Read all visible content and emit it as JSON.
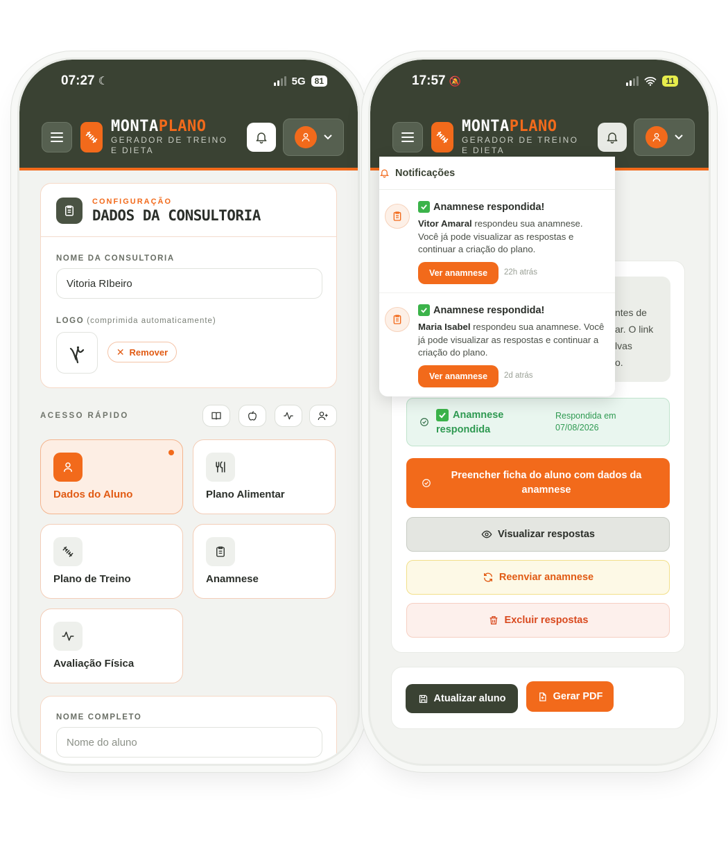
{
  "left": {
    "status": {
      "time": "07:27",
      "network": "5G",
      "battery": "81"
    },
    "brand": {
      "title_a": "MONTA",
      "title_b": "PLANO",
      "subtitle": "GERADOR DE TREINO E DIETA"
    },
    "config_card": {
      "eyebrow": "CONFIGURAÇÃO",
      "title": "DADOS DA CONSULTORIA",
      "name_label": "NOME DA CONSULTORIA",
      "name_value": "Vitoria RIbeiro",
      "logo_label": "LOGO",
      "logo_hint": "(comprimida automaticamente)",
      "remove_label": "Remover"
    },
    "quick_access": {
      "label": "ACESSO RÁPIDO",
      "tiles": [
        {
          "label": "Dados do Aluno",
          "icon": "user-icon",
          "active": true
        },
        {
          "label": "Plano Alimentar",
          "icon": "fork-knife-icon",
          "active": false
        },
        {
          "label": "Plano de Treino",
          "icon": "dumbbell-icon",
          "active": false
        },
        {
          "label": "Anamnese",
          "icon": "clipboard-icon",
          "active": false
        },
        {
          "label": "Avaliação Física",
          "icon": "pulse-icon",
          "active": false
        }
      ]
    },
    "student_card": {
      "label": "NOME COMPLETO",
      "placeholder": "Nome do aluno"
    }
  },
  "right": {
    "status": {
      "time": "17:57",
      "battery": "11"
    },
    "brand": {
      "title_a": "MONTA",
      "title_b": "PLANO",
      "subtitle": "GERADOR DE TREINO E DIETA"
    },
    "notifications": {
      "title": "Notificações",
      "items": [
        {
          "title": "Anamnese respondida!",
          "name": "Vitor Amaral",
          "text": " respondeu sua anamnese. Você já pode visualizar as respostas e continuar a criação do plano.",
          "button": "Ver anamnese",
          "time": "22h atrás"
        },
        {
          "title": "Anamnese respondida!",
          "name": "Maria Isabel",
          "text": " respondeu sua anamnese. Você já pode visualizar as respostas e continuar a criação do plano.",
          "button": "Ver anamnese",
          "time": "2d atrás"
        }
      ]
    },
    "hidden_text_fragments": [
      "ntes de",
      "ar. O link",
      "lvas",
      "o."
    ],
    "anamnese_status": {
      "label": "Anamnese respondida",
      "date_label": "Respondida em",
      "date": "07/08/2026"
    },
    "buttons": {
      "fill": "Preencher ficha do aluno com dados da anamnese",
      "view": "Visualizar respostas",
      "resend": "Reenviar anamnese",
      "delete": "Excluir respostas",
      "update": "Atualizar aluno",
      "pdf": "Gerar PDF"
    }
  },
  "colors": {
    "brand_dark": "#3a4233",
    "accent": "#f26a1b",
    "success": "#2f9a52"
  }
}
